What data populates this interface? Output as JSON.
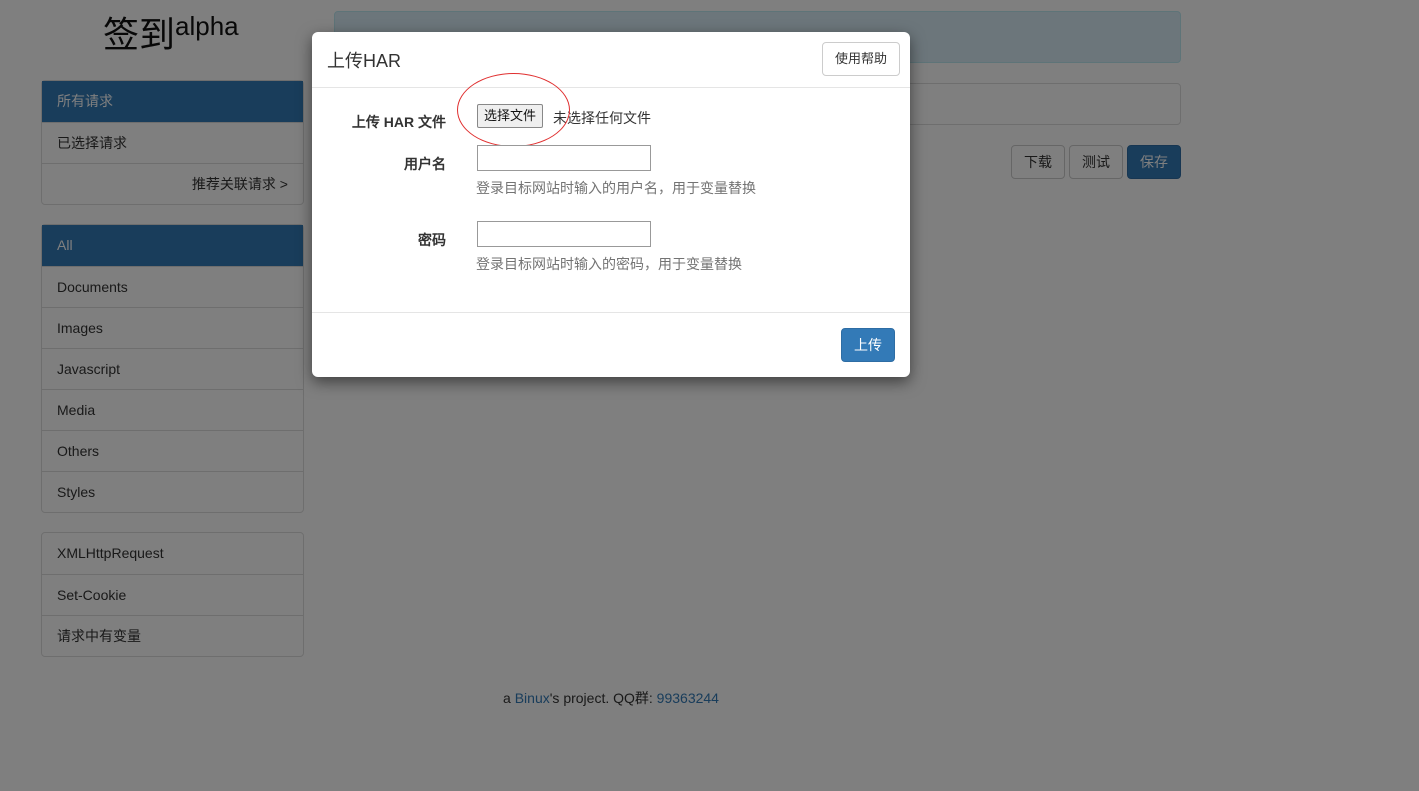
{
  "brand": {
    "title": "签到",
    "superscript": "alpha"
  },
  "sidebar": {
    "group1": [
      {
        "label": "所有请求",
        "active": true
      },
      {
        "label": "已选择请求"
      },
      {
        "label": "推荐关联请求 >"
      }
    ],
    "group2": [
      {
        "label": "All",
        "active": true
      },
      {
        "label": "Documents"
      },
      {
        "label": "Images"
      },
      {
        "label": "Javascript"
      },
      {
        "label": "Media"
      },
      {
        "label": "Others"
      },
      {
        "label": "Styles"
      }
    ],
    "group3": [
      {
        "label": "XMLHttpRequest"
      },
      {
        "label": "Set-Cookie"
      },
      {
        "label": "请求中有变量"
      }
    ]
  },
  "toolbar": {
    "download_label": "下载",
    "test_label": "测试",
    "save_label": "保存"
  },
  "footer": {
    "prefix": "a ",
    "author": "Binux",
    "middle": "'s project. QQ群: ",
    "qq": "99363244"
  },
  "modal": {
    "title": "上传HAR",
    "help_label": "使用帮助",
    "file_label": "上传 HAR 文件",
    "file_button": "选择文件",
    "file_status": "未选择任何文件",
    "username_label": "用户名",
    "username_value": "",
    "username_help": "登录目标网站时输入的用户名，用于变量替换",
    "password_label": "密码",
    "password_value": "",
    "password_help": "登录目标网站时输入的密码，用于变量替换",
    "upload_label": "上传"
  },
  "colors": {
    "primary": "#337ab7",
    "annotation": "#e03030",
    "backdrop": "rgba(0,0,0,0.5)"
  }
}
